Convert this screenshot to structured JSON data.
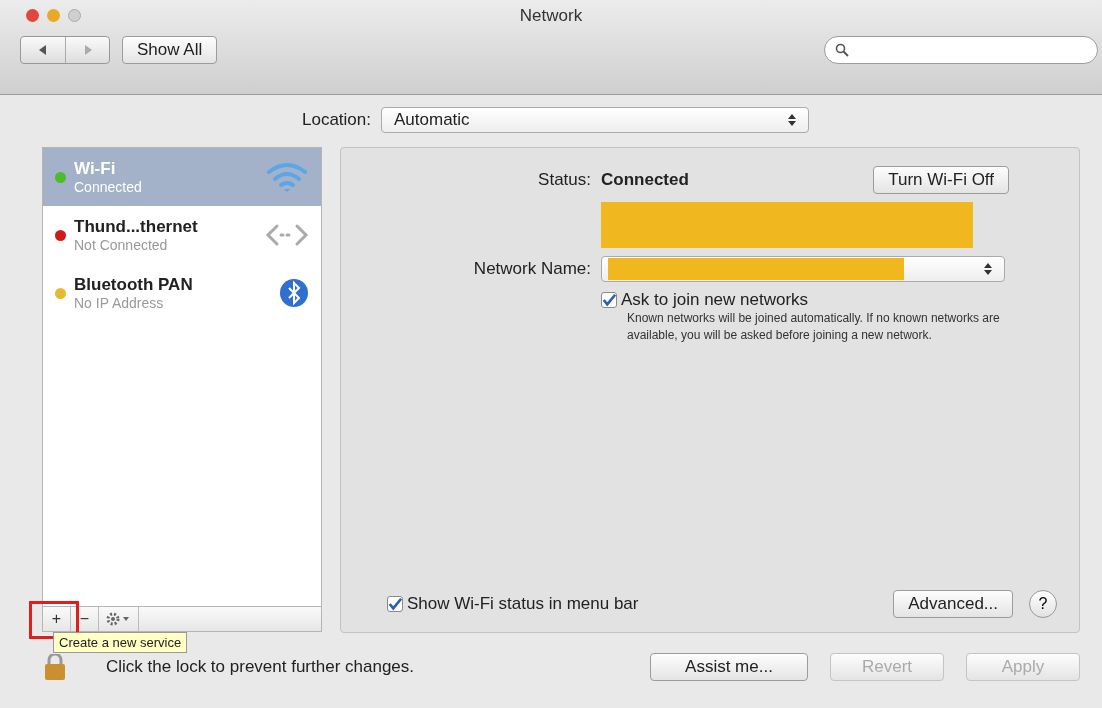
{
  "window": {
    "title": "Network"
  },
  "toolbar": {
    "show_all": "Show All"
  },
  "location": {
    "label": "Location:",
    "value": "Automatic"
  },
  "services": [
    {
      "kind": "wifi",
      "name": "Wi-Fi",
      "status": "Connected",
      "color": "#4cbb2c",
      "selected": true
    },
    {
      "kind": "ethernet",
      "name": "Thund...thernet",
      "status": "Not Connected",
      "color": "#d0191b",
      "selected": false
    },
    {
      "kind": "bluetooth",
      "name": "Bluetooth PAN",
      "status": "No IP Address",
      "color": "#e8b830",
      "selected": false
    }
  ],
  "list_buttons": {
    "add": "+",
    "remove": "−"
  },
  "detail": {
    "status_label": "Status:",
    "status_value": "Connected",
    "turn_off": "Turn Wi-Fi Off",
    "network_name_label": "Network Name:",
    "ask_join": {
      "label": "Ask to join new networks",
      "checked": true,
      "description": "Known networks will be joined automatically. If no known networks are available, you will be asked before joining a new network."
    },
    "show_status": {
      "label": "Show Wi-Fi status in menu bar",
      "checked": true
    },
    "advanced": "Advanced...",
    "help": "?"
  },
  "tooltip": "Create a new service",
  "lock_text": "Click the lock to prevent further changes.",
  "buttons": [
    {
      "label": "Assist me...",
      "disabled": false
    },
    {
      "label": "Revert",
      "disabled": true
    },
    {
      "label": "Apply",
      "disabled": true
    }
  ]
}
